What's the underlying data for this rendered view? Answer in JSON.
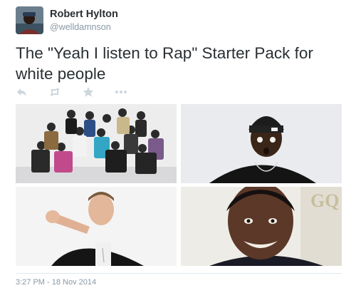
{
  "author": {
    "display_name": "Robert Hylton",
    "screen_name": "@welldamnson"
  },
  "tweet": {
    "text": "The \"Yeah I listen to Rap\" Starter Pack for white people",
    "timestamp": "3:27 PM - 18 Nov 2014"
  },
  "actions": [
    {
      "icon": "reply-icon"
    },
    {
      "icon": "retweet-icon"
    },
    {
      "icon": "favorite-star-icon"
    },
    {
      "icon": "more-dots-icon"
    }
  ],
  "media": [
    {
      "icon": "group-photo"
    },
    {
      "icon": "portrait-beanie"
    },
    {
      "icon": "portrait-pointing"
    },
    {
      "icon": "portrait-smiling"
    }
  ],
  "colors": {
    "text": "#292f33",
    "secondary": "#8899a6",
    "icon": "#ccd6dd",
    "divider": "#e1e8ed"
  }
}
